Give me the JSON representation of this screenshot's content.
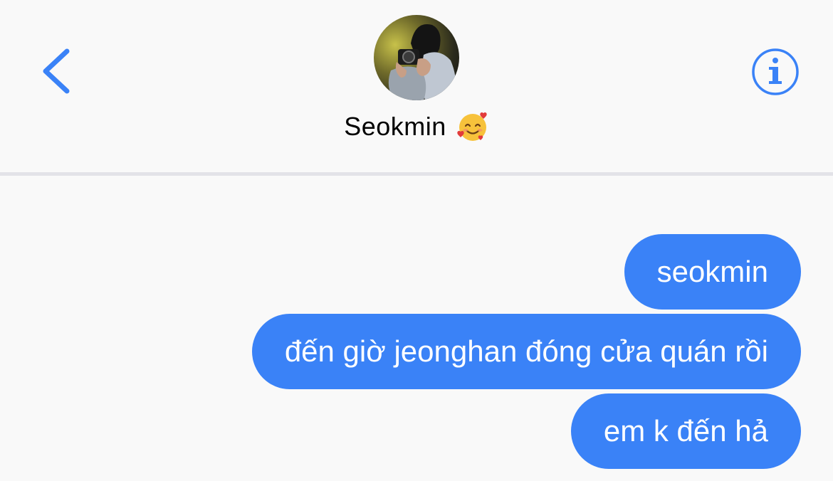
{
  "header": {
    "contact_name": "Seokmin",
    "contact_emoji": "smiling-face-with-hearts-icon"
  },
  "icons": {
    "back": "chevron-left-icon",
    "info": "info-icon"
  },
  "colors": {
    "accent": "#3a82f7",
    "background": "#f9f9f9",
    "divider": "#e3e3e8"
  },
  "messages": [
    {
      "text": "seokmin"
    },
    {
      "text": "đến giờ jeonghan đóng cửa quán rồi"
    },
    {
      "text": "em k đến hả"
    }
  ]
}
